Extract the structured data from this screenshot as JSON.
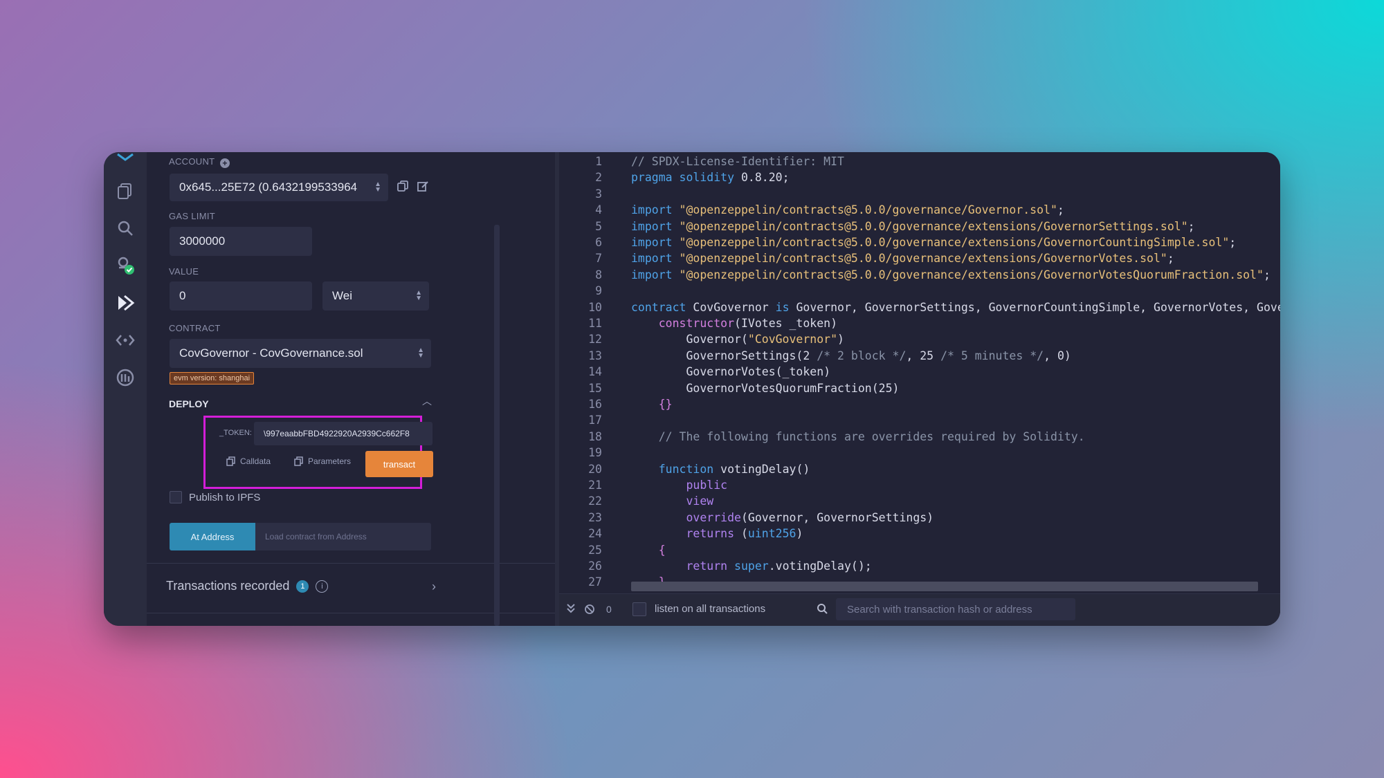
{
  "account": {
    "label": "ACCOUNT",
    "value": "0x645...25E72 (0.6432199533964"
  },
  "gas_limit": {
    "label": "GAS LIMIT",
    "value": "3000000"
  },
  "value": {
    "label": "VALUE",
    "amount": "0",
    "unit": "Wei"
  },
  "contract": {
    "label": "CONTRACT",
    "value": "CovGovernor - CovGovernance.sol",
    "evm_badge": "evm version: shanghai"
  },
  "deploy": {
    "label": "DEPLOY",
    "token_label": "_TOKEN:",
    "token_value": "\\997eaabbFBD4922920A2939Cc662F8",
    "calldata_label": "Calldata",
    "parameters_label": "Parameters",
    "transact_label": "transact"
  },
  "publish_ipfs": "Publish to IPFS",
  "at_address": {
    "button": "At Address",
    "placeholder": "Load contract from Address"
  },
  "transactions": {
    "label": "Transactions recorded",
    "count": "1"
  },
  "bottom_bar": {
    "counter": "0",
    "listen_label": "listen on all transactions",
    "search_placeholder": "Search with transaction hash or address"
  },
  "colors": {
    "accent_orange": "#e6853a",
    "at_address_blue": "#2e8ab3",
    "highlight_magenta": "#d31ed8",
    "badge_bg": "#6b3a22"
  },
  "icons": [
    "file-explorer-icon",
    "search-icon",
    "compiler-icon",
    "deploy-run-icon",
    "debugger-icon",
    "plugin-icon"
  ],
  "code_lines": [
    {
      "n": "1",
      "html": "<span class='c'>// SPDX-License-Identifier: MIT</span>"
    },
    {
      "n": "2",
      "html": "<span class='k'>pragma</span> <span class='k'>solidity</span> <span class='n'>0.8.20;</span>"
    },
    {
      "n": "3",
      "html": ""
    },
    {
      "n": "4",
      "html": "<span class='k'>import</span> <span class='s'>\"@openzeppelin/contracts@5.0.0/governance/Governor.sol\"</span><span class='n'>;</span>"
    },
    {
      "n": "5",
      "html": "<span class='k'>import</span> <span class='s'>\"@openzeppelin/contracts@5.0.0/governance/extensions/GovernorSettings.sol\"</span><span class='n'>;</span>"
    },
    {
      "n": "6",
      "html": "<span class='k'>import</span> <span class='s'>\"@openzeppelin/contracts@5.0.0/governance/extensions/GovernorCountingSimple.sol\"</span><span class='n'>;</span>"
    },
    {
      "n": "7",
      "html": "<span class='k'>import</span> <span class='s'>\"@openzeppelin/contracts@5.0.0/governance/extensions/GovernorVotes.sol\"</span><span class='n'>;</span>"
    },
    {
      "n": "8",
      "html": "<span class='k'>import</span> <span class='s'>\"@openzeppelin/contracts@5.0.0/governance/extensions/GovernorVotesQuorumFraction.sol\"</span><span class='n'>;</span>"
    },
    {
      "n": "9",
      "html": ""
    },
    {
      "n": "10",
      "html": "<span class='k'>contract</span> <span class='n'>CovGovernor</span> <span class='k'>is</span> <span class='n'>Governor, GovernorSettings, GovernorCountingSimple, GovernorVotes, GovernorVotes</span>"
    },
    {
      "n": "11",
      "html": "    <span class='f'>constructor</span><span class='n'>(IVotes _token)</span>"
    },
    {
      "n": "12",
      "html": "        <span class='n'>Governor(</span><span class='s'>\"CovGovernor\"</span><span class='n'>)</span>"
    },
    {
      "n": "13",
      "html": "        <span class='n'>GovernorSettings(2</span> <span class='c'>/* 2 block */</span><span class='n'>, 25</span> <span class='c'>/* 5 minutes */</span><span class='n'>, 0)</span>"
    },
    {
      "n": "14",
      "html": "        <span class='n'>GovernorVotes(_token)</span>"
    },
    {
      "n": "15",
      "html": "        <span class='n'>GovernorVotesQuorumFraction(25)</span>"
    },
    {
      "n": "16",
      "html": "    <span class='f'>{}</span>"
    },
    {
      "n": "17",
      "html": ""
    },
    {
      "n": "18",
      "html": "    <span class='c'>// The following functions are overrides required by Solidity.</span>"
    },
    {
      "n": "19",
      "html": ""
    },
    {
      "n": "20",
      "html": "    <span class='k'>function</span> <span class='n'>votingDelay()</span>"
    },
    {
      "n": "21",
      "html": "        <span class='b'>public</span>"
    },
    {
      "n": "22",
      "html": "        <span class='b'>view</span>"
    },
    {
      "n": "23",
      "html": "        <span class='b'>override</span><span class='n'>(Governor, GovernorSettings)</span>"
    },
    {
      "n": "24",
      "html": "        <span class='b'>returns</span> <span class='n'>(</span><span class='k'>uint256</span><span class='n'>)</span>"
    },
    {
      "n": "25",
      "html": "    <span class='f'>{</span>"
    },
    {
      "n": "26",
      "html": "        <span class='b'>return</span> <span class='k'>super</span><span class='n'>.votingDelay();</span>"
    },
    {
      "n": "27",
      "html": "    <span class='f'>}</span>"
    }
  ]
}
